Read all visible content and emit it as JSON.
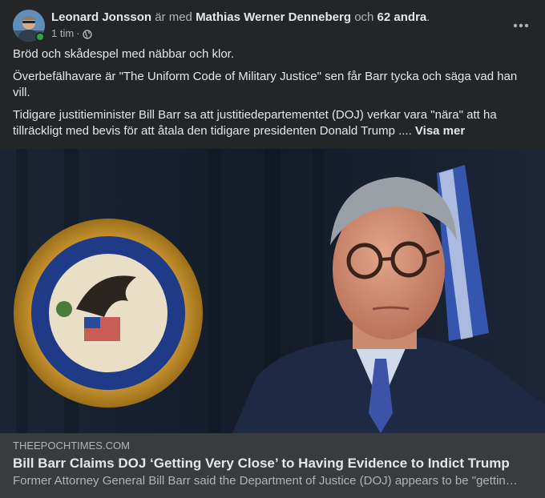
{
  "header": {
    "author": "Leonard Jonsson",
    "with_word": "är med",
    "tagged": "Mathias Werner Denneberg",
    "and_word": "och",
    "others": "62 andra",
    "period": ".",
    "time": "1 tim",
    "dot": "·"
  },
  "icons": {
    "privacy": "globe-icon",
    "more": "more-options-icon"
  },
  "post": {
    "para1": "Bröd och skådespel med näbbar och klor.",
    "para2": "Överbefälhavare  är \"The Uniform Code of Military Justice\" sen får Barr tycka och säga vad han vill.",
    "para3": "Tidigare justitieminister Bill Barr sa att justitiedepartementet (DOJ) verkar vara \"nära\" att ha tillräckligt med bevis för att åtala den tidigare presidenten Donald Trump .... ",
    "see_more": "Visa mer"
  },
  "link": {
    "domain": "THEEPOCHTIMES.COM",
    "title": "Bill Barr Claims DOJ ‘Getting Very Close’ to Having Evidence to Indict Trump",
    "description": "Former Attorney General Bill Barr said the Department of Justice (DOJ) appears to be \"gettin…"
  },
  "colors": {
    "background": "#242526",
    "card": "#3a3b3c",
    "text_primary": "#e4e6eb",
    "text_secondary": "#b0b3b8",
    "online": "#31a24c"
  }
}
